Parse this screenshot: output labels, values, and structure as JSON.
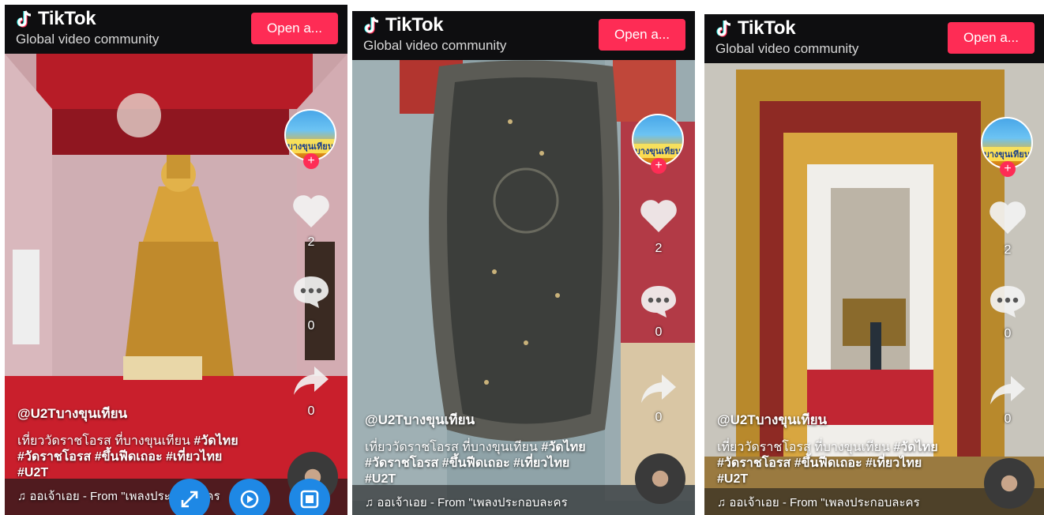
{
  "app": {
    "name": "TikTok",
    "tagline": "Global video community",
    "open_label": "Open a..."
  },
  "colors": {
    "accent": "#fe2c55",
    "header_bg": "#0e0e10",
    "control_blue": "#1e88e5"
  },
  "avatar_text": "บางขุนเทียน",
  "avatar_plus": "+",
  "panels": [
    {
      "likes": "2",
      "comments": "0",
      "shares": "0",
      "username": "@U2Tบางขุนเทียน",
      "caption_text": "เที่ยววัดราชโอรส ที่บางขุนเทียน ",
      "tags_line1": "#วัดไทย",
      "tags_line2": "#วัดราชโอรส #ขึ้นฟีดเถอะ #เที่ยวไทย",
      "tags_line3": "#U2T",
      "music": "ออเจ้าเอย - From \"เพลงประกอบละคร"
    },
    {
      "likes": "2",
      "comments": "0",
      "shares": "0",
      "username": "@U2Tบางขุนเทียน",
      "caption_text": "เที่ยววัดราชโอรส ที่บางขุนเทียน ",
      "tags_line1": "#วัดไทย",
      "tags_line2": "#วัดราชโอรส #ขึ้นฟีดเถอะ #เที่ยวไทย",
      "tags_line3": "#U2T",
      "music": "ออเจ้าเอย - From \"เพลงประกอบละคร"
    },
    {
      "likes": "2",
      "comments": "0",
      "shares": "0",
      "username": "@U2Tบางขุนเทียน",
      "caption_text": "เที่ยววัดราชโอรส ที่บางขุนเทียน ",
      "tags_line1": "#วัดไทย",
      "tags_line2": "#วัดราชโอรส #ขึ้นฟีดเถอะ #เที่ยวไทย",
      "tags_line3": "#U2T",
      "music": "ออเจ้าเอย - From \"เพลงประกอบละคร"
    }
  ],
  "icons": {
    "logo": "tiktok-logo-icon",
    "like": "heart-icon",
    "comment": "comment-icon",
    "share": "share-arrow-icon",
    "music": "music-note-icon",
    "fullscreen": "expand-icon",
    "replay": "replay-icon",
    "stop": "stop-icon"
  }
}
